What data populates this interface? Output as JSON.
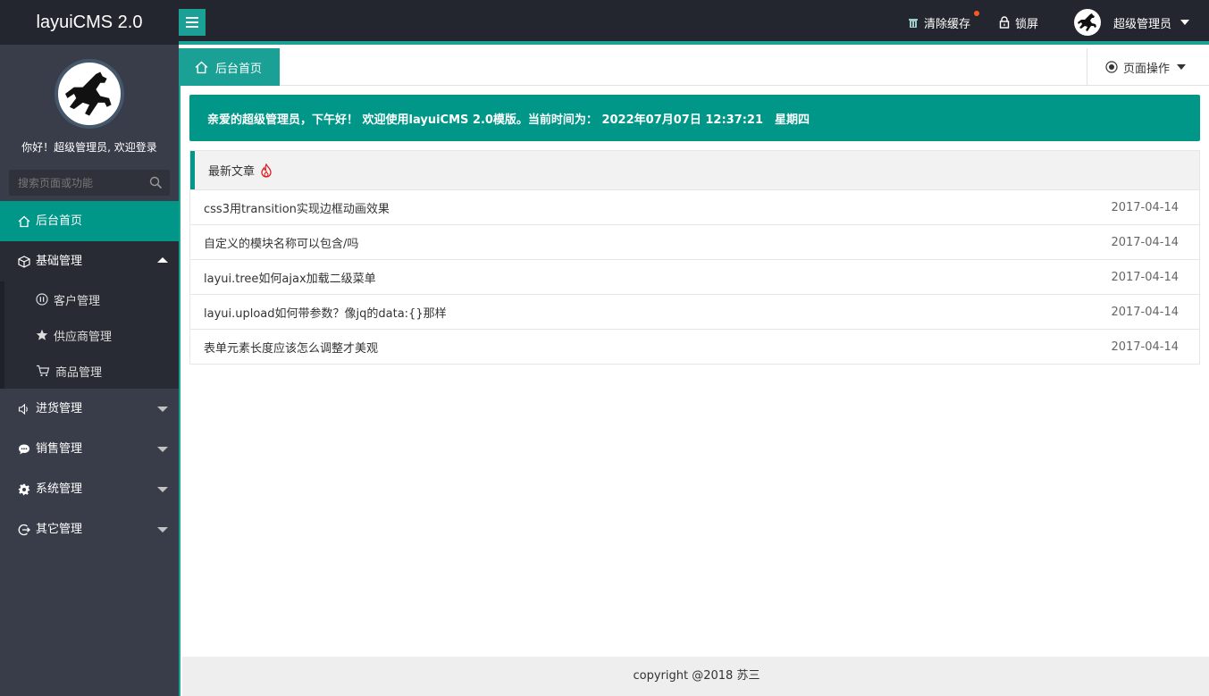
{
  "header": {
    "logo": "layuiCMS 2.0",
    "clear_cache": "清除缓存",
    "lock_screen": "锁屏",
    "user_name": "超级管理员"
  },
  "sidebar": {
    "welcome": "你好！超级管理员, 欢迎登录",
    "search_placeholder": "搜索页面或功能",
    "items": [
      {
        "label": "后台首页",
        "icon": "home-icon",
        "state": "active"
      },
      {
        "label": "基础管理",
        "icon": "cube-icon",
        "state": "expanded",
        "children": [
          {
            "label": "客户管理",
            "icon": "pause-circle-icon"
          },
          {
            "label": "供应商管理",
            "icon": "star-icon"
          },
          {
            "label": "商品管理",
            "icon": "cart-icon"
          }
        ]
      },
      {
        "label": "进货管理",
        "icon": "speaker-icon",
        "state": "collapsed"
      },
      {
        "label": "销售管理",
        "icon": "chat-icon",
        "state": "collapsed"
      },
      {
        "label": "系统管理",
        "icon": "gear-icon",
        "state": "collapsed"
      },
      {
        "label": "其它管理",
        "icon": "exit-icon",
        "state": "collapsed"
      }
    ]
  },
  "tabs": {
    "home_tab": "后台首页",
    "page_ops": "页面操作"
  },
  "banner": {
    "text": "亲爱的超级管理员，下午好！ 欢迎使用layuiCMS 2.0模版。当前时间为： 2022年07月07日 12:37:21　星期四"
  },
  "articles": {
    "title": "最新文章",
    "rows": [
      {
        "title": "css3用transition实现边框动画效果",
        "date": "2017-04-14"
      },
      {
        "title": "自定义的模块名称可以包含/吗",
        "date": "2017-04-14"
      },
      {
        "title": "layui.tree如何ajax加载二级菜单",
        "date": "2017-04-14"
      },
      {
        "title": "layui.upload如何带参数？像jq的data:{}那样",
        "date": "2017-04-14"
      },
      {
        "title": "表单元素长度应该怎么调整才美观",
        "date": "2017-04-14"
      }
    ]
  },
  "footer": {
    "text": "copyright @2018 苏三"
  },
  "colors": {
    "accent": "#009688",
    "accent_light": "#1aa094",
    "header_bg": "#23262e",
    "sidebar_bg": "#393d49",
    "badge_dot": "#ff5722"
  }
}
